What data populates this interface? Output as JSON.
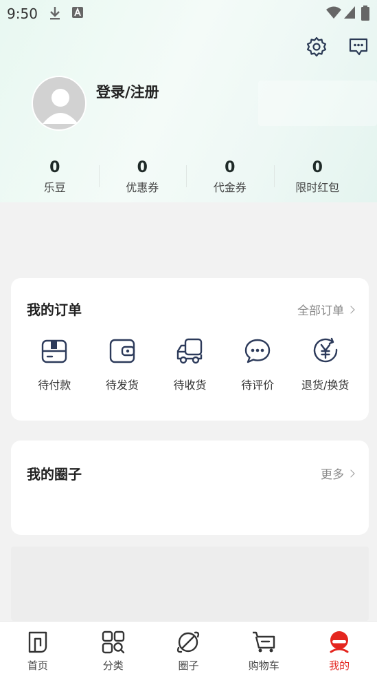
{
  "status_bar": {
    "time": "9:50"
  },
  "user": {
    "login_text": "登录/注册"
  },
  "stats": [
    {
      "value": "0",
      "label": "乐豆"
    },
    {
      "value": "0",
      "label": "优惠券"
    },
    {
      "value": "0",
      "label": "代金券"
    },
    {
      "value": "0",
      "label": "限时红包"
    }
  ],
  "orders": {
    "title": "我的订单",
    "all_link": "全部订单",
    "items": [
      {
        "label": "待付款",
        "icon": "pending-payment-icon"
      },
      {
        "label": "待发货",
        "icon": "wallet-icon"
      },
      {
        "label": "待收货",
        "icon": "truck-icon"
      },
      {
        "label": "待评价",
        "icon": "chat-bubble-icon"
      },
      {
        "label": "退货/换货",
        "icon": "yen-refund-icon"
      }
    ]
  },
  "circle": {
    "title": "我的圈子",
    "more_link": "更多"
  },
  "tabbar": [
    {
      "label": "首页",
      "icon": "home-icon"
    },
    {
      "label": "分类",
      "icon": "category-icon"
    },
    {
      "label": "圈子",
      "icon": "planet-icon"
    },
    {
      "label": "购物车",
      "icon": "cart-icon"
    },
    {
      "label": "我的",
      "icon": "profile-icon",
      "active": true
    }
  ],
  "colors": {
    "accent": "#e4261f",
    "icon_blue": "#2c3a5a",
    "header_tint": "#e8f8f1"
  }
}
